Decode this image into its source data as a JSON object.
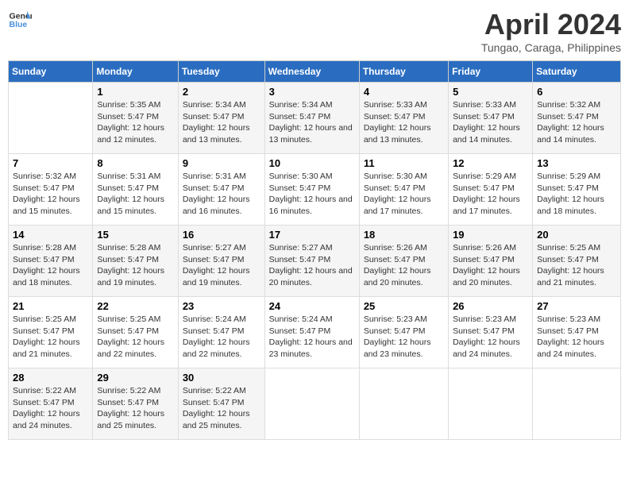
{
  "header": {
    "logo_line1": "General",
    "logo_line2": "Blue",
    "month_year": "April 2024",
    "location": "Tungao, Caraga, Philippines"
  },
  "days_of_week": [
    "Sunday",
    "Monday",
    "Tuesday",
    "Wednesday",
    "Thursday",
    "Friday",
    "Saturday"
  ],
  "weeks": [
    [
      {
        "day": "",
        "sunrise": "",
        "sunset": "",
        "daylight": ""
      },
      {
        "day": "1",
        "sunrise": "Sunrise: 5:35 AM",
        "sunset": "Sunset: 5:47 PM",
        "daylight": "Daylight: 12 hours and 12 minutes."
      },
      {
        "day": "2",
        "sunrise": "Sunrise: 5:34 AM",
        "sunset": "Sunset: 5:47 PM",
        "daylight": "Daylight: 12 hours and 13 minutes."
      },
      {
        "day": "3",
        "sunrise": "Sunrise: 5:34 AM",
        "sunset": "Sunset: 5:47 PM",
        "daylight": "Daylight: 12 hours and 13 minutes."
      },
      {
        "day": "4",
        "sunrise": "Sunrise: 5:33 AM",
        "sunset": "Sunset: 5:47 PM",
        "daylight": "Daylight: 12 hours and 13 minutes."
      },
      {
        "day": "5",
        "sunrise": "Sunrise: 5:33 AM",
        "sunset": "Sunset: 5:47 PM",
        "daylight": "Daylight: 12 hours and 14 minutes."
      },
      {
        "day": "6",
        "sunrise": "Sunrise: 5:32 AM",
        "sunset": "Sunset: 5:47 PM",
        "daylight": "Daylight: 12 hours and 14 minutes."
      }
    ],
    [
      {
        "day": "7",
        "sunrise": "Sunrise: 5:32 AM",
        "sunset": "Sunset: 5:47 PM",
        "daylight": "Daylight: 12 hours and 15 minutes."
      },
      {
        "day": "8",
        "sunrise": "Sunrise: 5:31 AM",
        "sunset": "Sunset: 5:47 PM",
        "daylight": "Daylight: 12 hours and 15 minutes."
      },
      {
        "day": "9",
        "sunrise": "Sunrise: 5:31 AM",
        "sunset": "Sunset: 5:47 PM",
        "daylight": "Daylight: 12 hours and 16 minutes."
      },
      {
        "day": "10",
        "sunrise": "Sunrise: 5:30 AM",
        "sunset": "Sunset: 5:47 PM",
        "daylight": "Daylight: 12 hours and 16 minutes."
      },
      {
        "day": "11",
        "sunrise": "Sunrise: 5:30 AM",
        "sunset": "Sunset: 5:47 PM",
        "daylight": "Daylight: 12 hours and 17 minutes."
      },
      {
        "day": "12",
        "sunrise": "Sunrise: 5:29 AM",
        "sunset": "Sunset: 5:47 PM",
        "daylight": "Daylight: 12 hours and 17 minutes."
      },
      {
        "day": "13",
        "sunrise": "Sunrise: 5:29 AM",
        "sunset": "Sunset: 5:47 PM",
        "daylight": "Daylight: 12 hours and 18 minutes."
      }
    ],
    [
      {
        "day": "14",
        "sunrise": "Sunrise: 5:28 AM",
        "sunset": "Sunset: 5:47 PM",
        "daylight": "Daylight: 12 hours and 18 minutes."
      },
      {
        "day": "15",
        "sunrise": "Sunrise: 5:28 AM",
        "sunset": "Sunset: 5:47 PM",
        "daylight": "Daylight: 12 hours and 19 minutes."
      },
      {
        "day": "16",
        "sunrise": "Sunrise: 5:27 AM",
        "sunset": "Sunset: 5:47 PM",
        "daylight": "Daylight: 12 hours and 19 minutes."
      },
      {
        "day": "17",
        "sunrise": "Sunrise: 5:27 AM",
        "sunset": "Sunset: 5:47 PM",
        "daylight": "Daylight: 12 hours and 20 minutes."
      },
      {
        "day": "18",
        "sunrise": "Sunrise: 5:26 AM",
        "sunset": "Sunset: 5:47 PM",
        "daylight": "Daylight: 12 hours and 20 minutes."
      },
      {
        "day": "19",
        "sunrise": "Sunrise: 5:26 AM",
        "sunset": "Sunset: 5:47 PM",
        "daylight": "Daylight: 12 hours and 20 minutes."
      },
      {
        "day": "20",
        "sunrise": "Sunrise: 5:25 AM",
        "sunset": "Sunset: 5:47 PM",
        "daylight": "Daylight: 12 hours and 21 minutes."
      }
    ],
    [
      {
        "day": "21",
        "sunrise": "Sunrise: 5:25 AM",
        "sunset": "Sunset: 5:47 PM",
        "daylight": "Daylight: 12 hours and 21 minutes."
      },
      {
        "day": "22",
        "sunrise": "Sunrise: 5:25 AM",
        "sunset": "Sunset: 5:47 PM",
        "daylight": "Daylight: 12 hours and 22 minutes."
      },
      {
        "day": "23",
        "sunrise": "Sunrise: 5:24 AM",
        "sunset": "Sunset: 5:47 PM",
        "daylight": "Daylight: 12 hours and 22 minutes."
      },
      {
        "day": "24",
        "sunrise": "Sunrise: 5:24 AM",
        "sunset": "Sunset: 5:47 PM",
        "daylight": "Daylight: 12 hours and 23 minutes."
      },
      {
        "day": "25",
        "sunrise": "Sunrise: 5:23 AM",
        "sunset": "Sunset: 5:47 PM",
        "daylight": "Daylight: 12 hours and 23 minutes."
      },
      {
        "day": "26",
        "sunrise": "Sunrise: 5:23 AM",
        "sunset": "Sunset: 5:47 PM",
        "daylight": "Daylight: 12 hours and 24 minutes."
      },
      {
        "day": "27",
        "sunrise": "Sunrise: 5:23 AM",
        "sunset": "Sunset: 5:47 PM",
        "daylight": "Daylight: 12 hours and 24 minutes."
      }
    ],
    [
      {
        "day": "28",
        "sunrise": "Sunrise: 5:22 AM",
        "sunset": "Sunset: 5:47 PM",
        "daylight": "Daylight: 12 hours and 24 minutes."
      },
      {
        "day": "29",
        "sunrise": "Sunrise: 5:22 AM",
        "sunset": "Sunset: 5:47 PM",
        "daylight": "Daylight: 12 hours and 25 minutes."
      },
      {
        "day": "30",
        "sunrise": "Sunrise: 5:22 AM",
        "sunset": "Sunset: 5:47 PM",
        "daylight": "Daylight: 12 hours and 25 minutes."
      },
      {
        "day": "",
        "sunrise": "",
        "sunset": "",
        "daylight": ""
      },
      {
        "day": "",
        "sunrise": "",
        "sunset": "",
        "daylight": ""
      },
      {
        "day": "",
        "sunrise": "",
        "sunset": "",
        "daylight": ""
      },
      {
        "day": "",
        "sunrise": "",
        "sunset": "",
        "daylight": ""
      }
    ]
  ]
}
